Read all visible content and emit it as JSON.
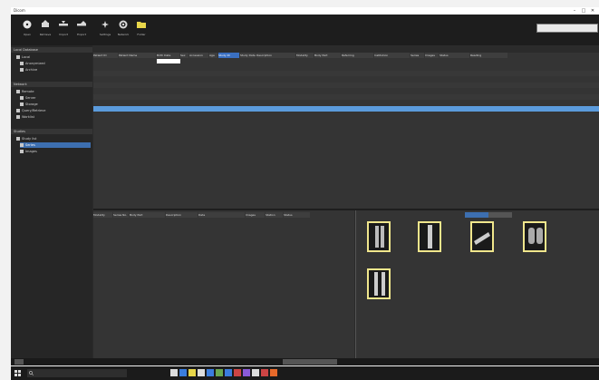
{
  "window": {
    "title": "Dicom",
    "min": "–",
    "max": "□",
    "close": "✕"
  },
  "toolbar": {
    "buttons": [
      {
        "label": "Open",
        "icon": "disc-icon"
      },
      {
        "label": "Retrieve",
        "icon": "export-icon"
      },
      {
        "label": "Import",
        "icon": "import-icon"
      },
      {
        "label": "Export",
        "icon": "send-icon"
      },
      {
        "label": "Settings",
        "icon": "settings-icon"
      },
      {
        "label": "Network",
        "icon": "globe-icon"
      },
      {
        "label": "Folder",
        "icon": "folder-icon"
      }
    ],
    "search_placeholder": "",
    "user": ""
  },
  "left_panel": {
    "sections": [
      {
        "title": "Local Database",
        "items": [
          "Local",
          "Anonymized",
          "Archive"
        ]
      },
      {
        "title": "Network",
        "items": [
          "Remote",
          "Server",
          "Storage",
          "Query/Retrieve",
          "Worklist"
        ]
      },
      {
        "title": "Studies",
        "items": [
          "Study list",
          "Series",
          "Images"
        ]
      }
    ],
    "selected": "Series"
  },
  "grid": {
    "info": "",
    "columns": [
      "Patient ID",
      "Patient Name",
      "Birth Date",
      "Sex",
      "Accession",
      "Age",
      "Study ID",
      "Study Date",
      "Description",
      "Modality",
      "Body Part",
      "Referring",
      "Institution",
      "Series",
      "Images",
      "Status",
      "Reading"
    ],
    "rows": [
      [
        "",
        "",
        "",
        "",
        "",
        "",
        "",
        "",
        "",
        "",
        "",
        "",
        "",
        "",
        "",
        "",
        ""
      ],
      [
        "",
        "",
        "",
        "",
        "",
        "",
        "",
        "",
        "",
        "",
        "",
        "",
        "",
        "",
        "",
        "",
        ""
      ],
      [
        "",
        "",
        "",
        "",
        "",
        "",
        "",
        "",
        "",
        "",
        "",
        "",
        "",
        "",
        "",
        "",
        ""
      ],
      [
        "",
        "",
        "",
        "",
        "",
        "",
        "",
        "",
        "",
        "",
        "",
        "",
        "",
        "",
        "",
        "",
        ""
      ],
      [
        "",
        "",
        "",
        "",
        "",
        "",
        "",
        "",
        "",
        "",
        "",
        "",
        "",
        "",
        "",
        "",
        ""
      ],
      [
        "",
        "",
        "",
        "",
        "",
        "",
        "",
        "",
        "",
        "",
        "",
        "",
        "",
        "",
        "",
        "",
        ""
      ],
      [
        "",
        "",
        "",
        "",
        "",
        "",
        "",
        "",
        "",
        "",
        "",
        "",
        "",
        "",
        "",
        "",
        ""
      ],
      [
        "",
        "",
        "",
        "",
        "",
        "",
        "",
        "",
        "",
        "",
        "",
        "",
        "",
        "",
        "",
        "",
        ""
      ],
      [
        "",
        "",
        "",
        "",
        "",
        "",
        "",
        "",
        "",
        "",
        "",
        "",
        "",
        "",
        "",
        "",
        ""
      ]
    ],
    "selected_row": 7
  },
  "series_grid": {
    "columns": [
      "Modality",
      "Series No.",
      "Body Part",
      "Description",
      "Date",
      "Images",
      "Station",
      "Status"
    ],
    "rows": [
      [
        "",
        "",
        "",
        "",
        "",
        "",
        "",
        ""
      ],
      [
        "",
        "",
        "",
        "",
        "",
        "",
        "",
        ""
      ],
      [
        "",
        "",
        "",
        "",
        "",
        "",
        "",
        ""
      ],
      [
        "",
        "",
        "",
        "",
        "",
        "",
        "",
        ""
      ],
      [
        "",
        "",
        "",
        "",
        "",
        "",
        "",
        ""
      ]
    ]
  },
  "thumbnails": {
    "tabs": [
      "",
      ""
    ],
    "items": [
      {
        "caption": "",
        "kind": "knee-xray"
      },
      {
        "caption": "",
        "kind": "leg-xray"
      },
      {
        "caption": "",
        "kind": "foot-xray"
      },
      {
        "caption": "",
        "kind": "chest-xray"
      },
      {
        "caption": "",
        "kind": "knees-xray"
      }
    ]
  },
  "status_bar": {
    "left": "",
    "center": "",
    "right": ""
  },
  "taskbar": {
    "search_placeholder": "",
    "time": "",
    "date": ""
  },
  "colors": {
    "accent": "#3d6fb0",
    "selection": "#5b9bdc",
    "thumb_border": "#f0e68c",
    "panel": "#2b2b2b"
  }
}
